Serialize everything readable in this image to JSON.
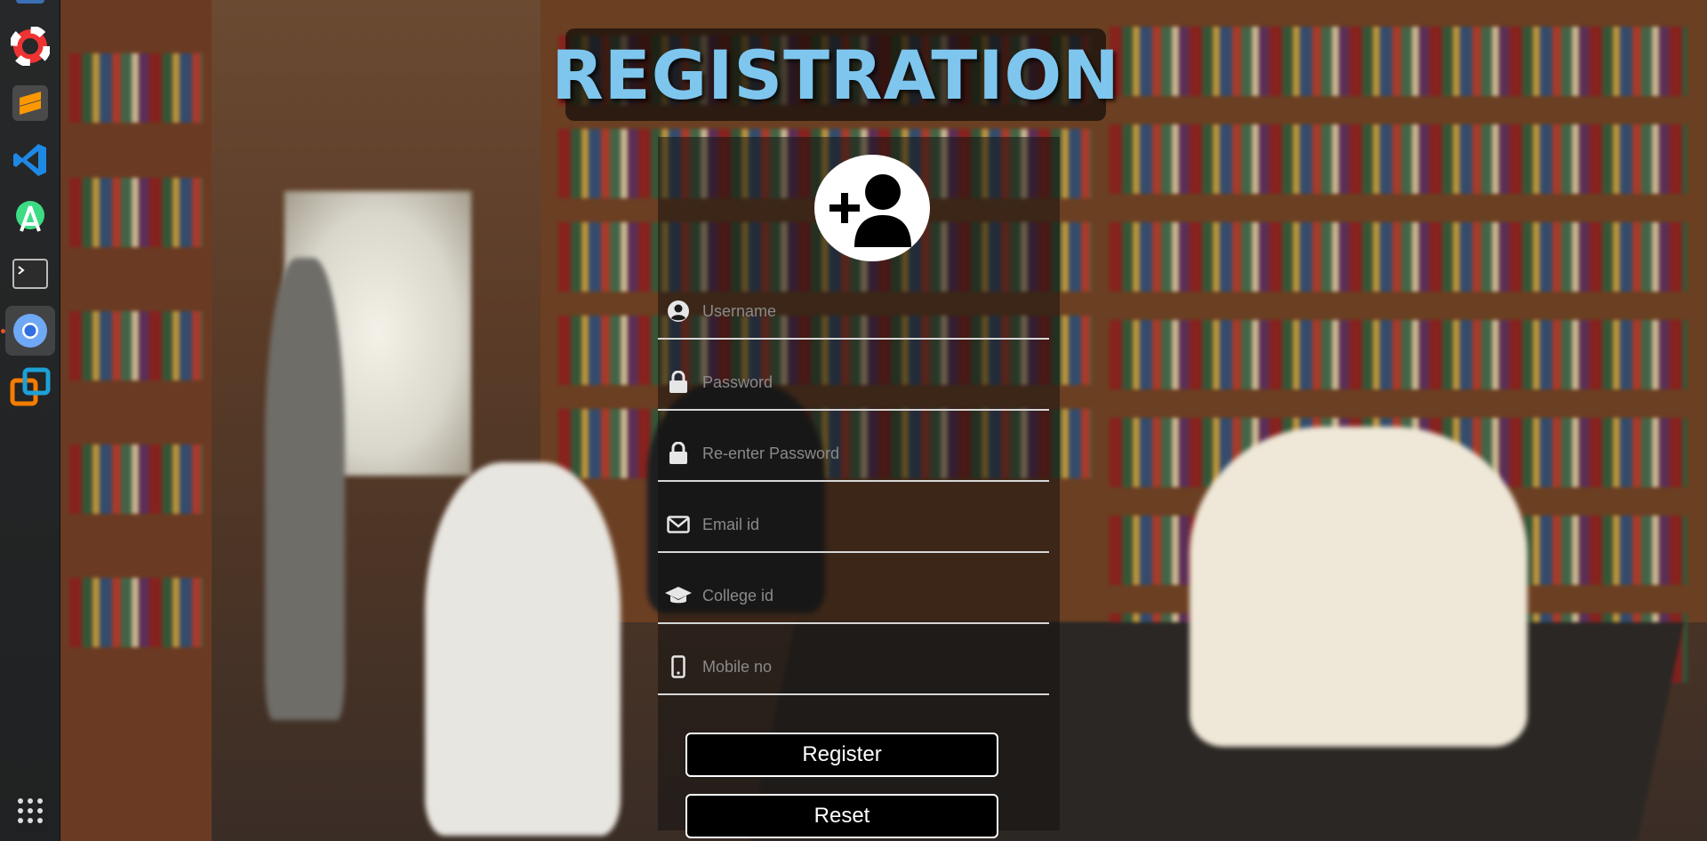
{
  "dock": {
    "items": [
      {
        "name": "help-lifebuoy-icon"
      },
      {
        "name": "sublime-text-icon"
      },
      {
        "name": "vscode-icon"
      },
      {
        "name": "android-studio-icon"
      },
      {
        "name": "terminal-icon"
      },
      {
        "name": "chromium-icon"
      },
      {
        "name": "virtualbox-icon"
      }
    ],
    "apps_grid": "show-applications-icon"
  },
  "page": {
    "title": "REGISTRATION"
  },
  "form": {
    "fields": [
      {
        "placeholder": "Username",
        "icon": "user-circle-icon",
        "type": "text"
      },
      {
        "placeholder": "Password",
        "icon": "lock-icon",
        "type": "password"
      },
      {
        "placeholder": "Re-enter Password",
        "icon": "lock-icon",
        "type": "password"
      },
      {
        "placeholder": "Email id",
        "icon": "envelope-icon",
        "type": "text"
      },
      {
        "placeholder": "College id",
        "icon": "graduation-cap-icon",
        "type": "text"
      },
      {
        "placeholder": "Mobile no",
        "icon": "mobile-phone-icon",
        "type": "text"
      }
    ],
    "register_label": "Register",
    "reset_label": "Reset"
  },
  "colors": {
    "title": "#7ec6ee",
    "button_bg": "#000000",
    "button_border": "#ffffff"
  }
}
